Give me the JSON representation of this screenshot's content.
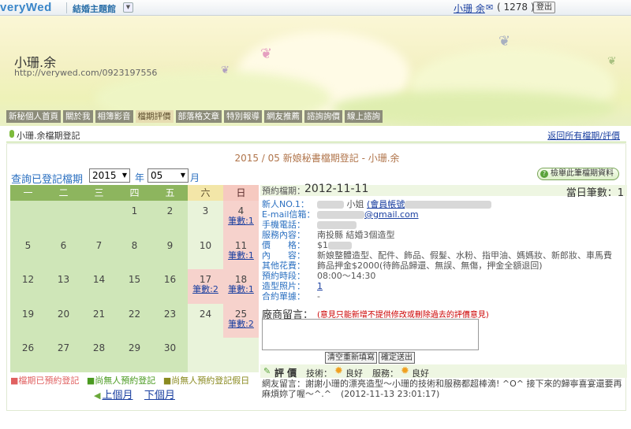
{
  "topbar": {
    "logo": "veryWed",
    "site_menu": "結婚主題館",
    "dropdown": "▼",
    "user_name": "小珊 余",
    "mail_icon": "mail-icon",
    "msg_count": "( 1278 )",
    "logout": "登出"
  },
  "banner": {
    "name": "小珊.余",
    "url": "http://verywed.com/0923197556"
  },
  "nav": [
    "新秘個人首頁",
    "關於我",
    "相簿影音",
    "檔期評價",
    "部落格文章",
    "特別報導",
    "網友推薦",
    "諮詢詢價",
    "線上諮詢"
  ],
  "nav_active": 3,
  "section": {
    "title": "小珊.余檔期登記",
    "back_link": "返回所有檔期/評價"
  },
  "period_title": "2015 / 05 新娘秘書檔期登記 - 小珊.余",
  "query": {
    "label": "查詢已登記檔期",
    "year": "2015",
    "year_unit": "年",
    "month": "05",
    "month_unit": "月"
  },
  "print_button": "檢舉此筆檔期資料",
  "calendar": {
    "headers": [
      "一",
      "二",
      "三",
      "四",
      "五",
      "六",
      "日"
    ],
    "rows": [
      [
        {
          "d": ""
        },
        {
          "d": ""
        },
        {
          "d": ""
        },
        {
          "d": "1"
        },
        {
          "d": "2"
        },
        {
          "d": "3"
        },
        {
          "d": "4",
          "c": "筆數:1"
        }
      ],
      [
        {
          "d": "5"
        },
        {
          "d": "6"
        },
        {
          "d": "7"
        },
        {
          "d": "8"
        },
        {
          "d": "9"
        },
        {
          "d": "10"
        },
        {
          "d": "11",
          "c": "筆數:1"
        }
      ],
      [
        {
          "d": "12"
        },
        {
          "d": "13"
        },
        {
          "d": "14"
        },
        {
          "d": "15"
        },
        {
          "d": "16"
        },
        {
          "d": "17",
          "c": "筆數:2"
        },
        {
          "d": "18",
          "c": "筆數:1"
        }
      ],
      [
        {
          "d": "19"
        },
        {
          "d": "20"
        },
        {
          "d": "21"
        },
        {
          "d": "22"
        },
        {
          "d": "23"
        },
        {
          "d": "24"
        },
        {
          "d": "25",
          "c": "筆數:2"
        }
      ],
      [
        {
          "d": "26"
        },
        {
          "d": "27"
        },
        {
          "d": "28"
        },
        {
          "d": "29"
        },
        {
          "d": "30"
        },
        {
          "d": ""
        },
        {
          "d": ""
        }
      ]
    ],
    "legend": [
      "■檔期已預約登記",
      "■尚無人預約登記",
      "■尚無人預約登記假日"
    ],
    "prev": "上個月",
    "next": "下個月"
  },
  "detail": {
    "date_label": "預約檔期：",
    "date": "2012-11-11",
    "daily_count": "當日筆數：1",
    "rows": [
      {
        "k": "新人NO.1：",
        "v": "小姐",
        "extra": "(會員帳號"
      },
      {
        "k": "E-mail信箱：",
        "v": "@gmail.com"
      },
      {
        "k": "手機電話：",
        "v": ""
      },
      {
        "k": "服務內容：",
        "v": "南投縣 結婚3個造型"
      },
      {
        "k": "價　　格：",
        "v": "$1"
      },
      {
        "k": "內　　容：",
        "v": "新娘整體造型、配件、飾品、假髮、水粉、指甲油、媽媽妝、新郎妝、車馬費"
      },
      {
        "k": "其他花費：",
        "v": "飾品押金$2000(待飾品歸還、無誤、無傷，押金全額退回)"
      },
      {
        "k": "預約時段：",
        "v": "08:00～14:30"
      },
      {
        "k": "造型照片：",
        "v": "1"
      },
      {
        "k": "合約單據：",
        "v": "-"
      }
    ],
    "comment_label": "廠商留言：",
    "comment_note": "(意見只能新增不提供修改或刪除過去的評價意見)",
    "clear_button": "清空重新填寫",
    "submit_button": "確定送出",
    "rating_label": "評 價",
    "tech_label": "技術：",
    "tech_value": "良好",
    "service_label": "服務：",
    "service_value": "良好",
    "guest_comment": "網友留言：謝謝小珊的漂亮造型～小珊的技術和服務都超棒滴! ^O^ 接下來的歸寧喜宴還要再麻煩妳了喔～^.^",
    "guest_time": "(2012-11-13 23:01:17)"
  },
  "colors": {
    "accent_blue": "#2a6fc0",
    "green_header": "#8db55e",
    "booked_pink": "#f6d2cc",
    "free_green": "#cfe6b8"
  }
}
